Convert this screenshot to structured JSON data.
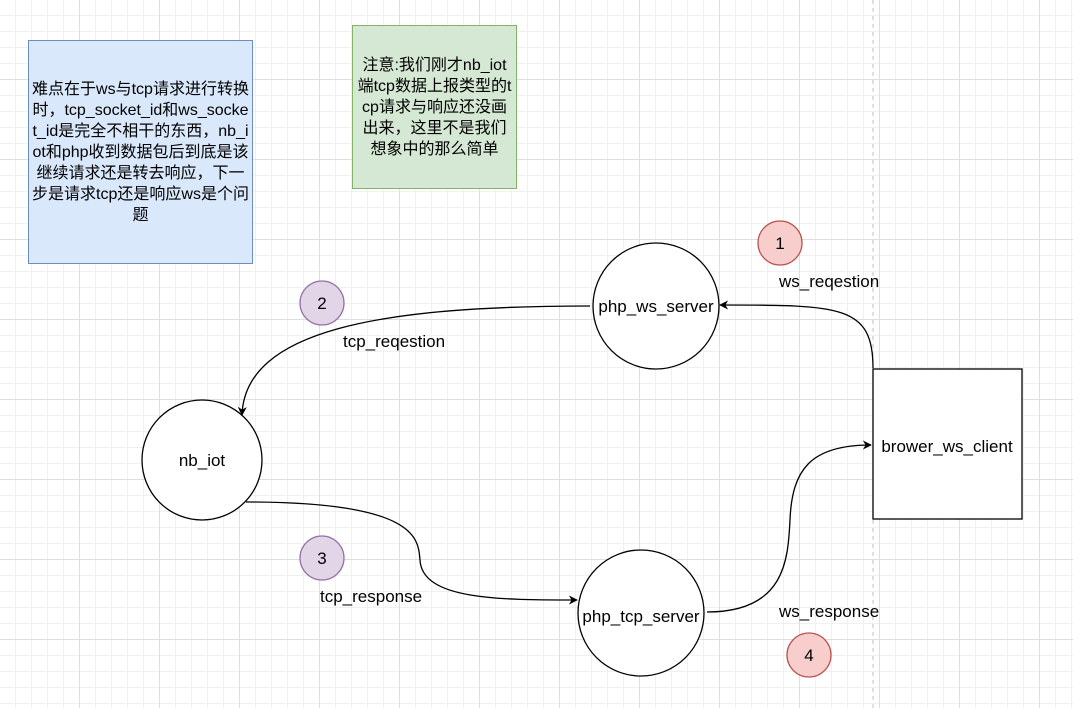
{
  "notes": {
    "left": "难点在于ws与tcp请求进行转换时，tcp_socket_id和ws_socket_id是完全不相干的东西，nb_iot和php收到数据包后到底是该继续请求还是转去响应，下一步是请求tcp还是响应ws是个问题",
    "green": "注意:我们刚才nb_iot端tcp数据上报类型的tcp请求与响应还没画出来，这里不是我们想象中的那么简单"
  },
  "nodes": {
    "php_ws_server": "php_ws_server",
    "nb_iot": "nb_iot",
    "php_tcp_server": "php_tcp_server",
    "brower_ws_client": "brower_ws_client"
  },
  "edges": {
    "ws_request": "ws_reqestion",
    "tcp_request": "tcp_reqestion",
    "tcp_response": "tcp_response",
    "ws_response": "ws_response"
  },
  "badges": {
    "b1": "1",
    "b2": "2",
    "b3": "3",
    "b4": "4"
  },
  "colors": {
    "red_badge_fill": "#f8cecc",
    "red_badge_stroke": "#b85450",
    "purple_badge_fill": "#e1d5e7",
    "purple_badge_stroke": "#9673a6",
    "blue_note_fill": "#dae8fc",
    "green_note_fill": "#d5e8d4"
  }
}
